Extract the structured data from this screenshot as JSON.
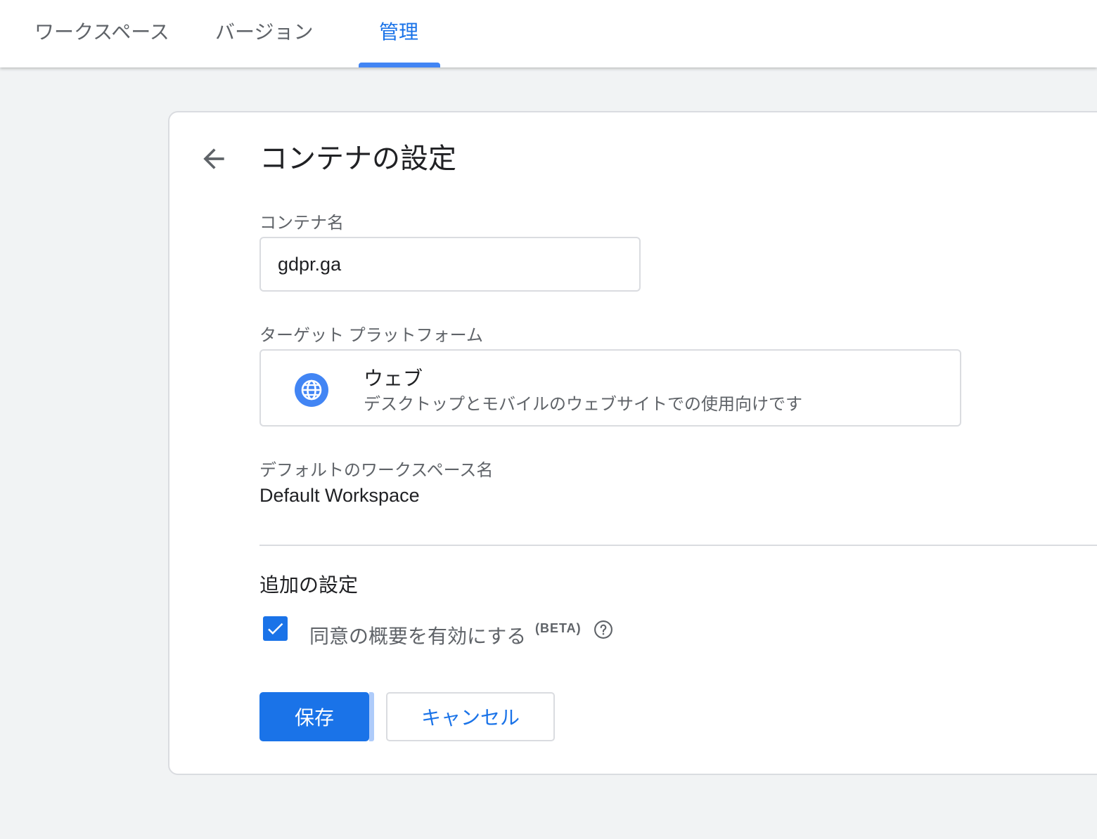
{
  "tabs": [
    {
      "label": "ワークスペース",
      "active": false
    },
    {
      "label": "バージョン",
      "active": false
    },
    {
      "label": "管理",
      "active": true
    }
  ],
  "colors": {
    "accent": "#1a73e8",
    "tab_indicator": "#4285f4",
    "page_background": "#f1f3f4",
    "border": "#dadce0",
    "secondary_text": "#5f6368"
  },
  "settings": {
    "title": "コンテナの設定",
    "back_icon": "arrow-back-icon",
    "container_name": {
      "label": "コンテナ名",
      "value": "gdpr.ga"
    },
    "target_platform": {
      "label": "ターゲット プラットフォーム",
      "icon": "globe-icon",
      "title": "ウェブ",
      "description": "デスクトップとモバイルのウェブサイトでの使用向けです"
    },
    "default_workspace": {
      "label": "デフォルトのワークスペース名",
      "value": "Default Workspace"
    },
    "additional": {
      "title": "追加の設定",
      "consent_overview": {
        "label": "同意の概要を有効にする",
        "badge": "(BETA)",
        "checked": true,
        "help_icon": "help-circle-icon"
      }
    },
    "actions": {
      "save": "保存",
      "cancel": "キャンセル"
    }
  }
}
